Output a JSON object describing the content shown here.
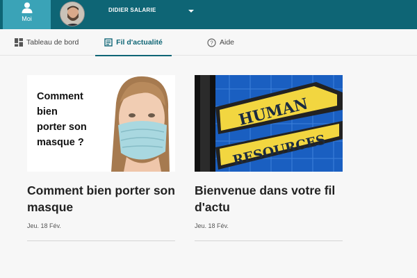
{
  "topbar": {
    "moi_label": "Moi",
    "username": "DIDIER SALARIE",
    "colors": {
      "bar": "#0e6575",
      "active_tab": "#3aa3b7"
    }
  },
  "nav": {
    "tabs": [
      {
        "label": "Tableau de bord",
        "icon": "dashboard-grid-icon"
      },
      {
        "label": "Fil d'actualité",
        "icon": "newsfeed-icon",
        "active": true
      },
      {
        "label": "Aide",
        "icon": "help-circle-icon"
      }
    ]
  },
  "cards": [
    {
      "image_text": [
        "Comment",
        "bien",
        "porter son",
        "masque ?"
      ],
      "title": "Comment bien porter son masque",
      "date": "Jeu. 18 Fév."
    },
    {
      "image_signs": [
        "HUMAN",
        "RESOURCES"
      ],
      "title": "Bienvenue dans votre fil d'actu",
      "date": "Jeu. 18 Fév."
    }
  ]
}
